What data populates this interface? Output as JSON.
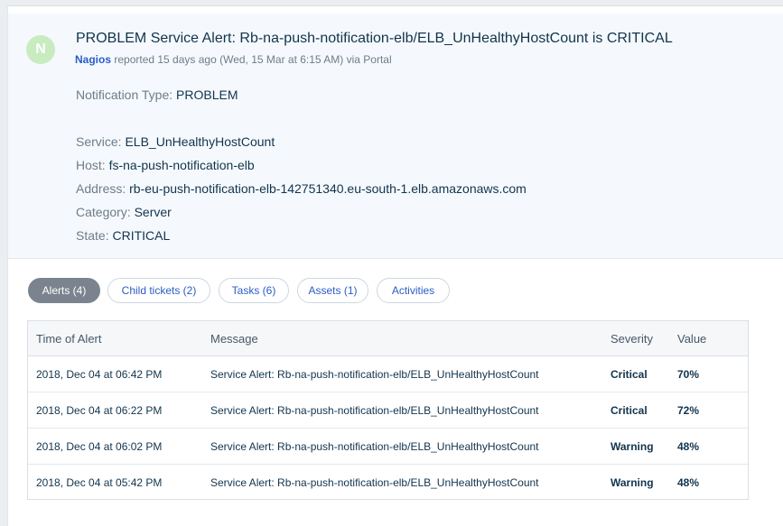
{
  "ticket": {
    "avatar_letter": "N",
    "title": "PROBLEM Service Alert: Rb-na-push-notification-elb/ELB_UnHealthyHostCount is CRITICAL",
    "agent": "Nagios",
    "meta_text": " reported 15 days ago (Wed, 15 Mar at 6:15 AM) via Portal"
  },
  "fields": {
    "notification_type_label": "Notification Type:",
    "notification_type_value": "PROBLEM",
    "service_label": "Service:",
    "service_value": "ELB_UnHealthyHostCount",
    "host_label": "Host:",
    "host_value": "fs-na-push-notification-elb",
    "address_label": "Address:",
    "address_value": "rb-eu-push-notification-elb-142751340.eu-south-1.elb.amazonaws.com",
    "category_label": "Category:",
    "category_value": "Server",
    "state_label": "State:",
    "state_value": "CRITICAL"
  },
  "tabs": [
    {
      "label": "Alerts (4)",
      "active": true
    },
    {
      "label": "Child tickets (2)",
      "active": false
    },
    {
      "label": "Tasks (6)",
      "active": false
    },
    {
      "label": "Assets (1)",
      "active": false
    },
    {
      "label": "Activities",
      "active": false
    }
  ],
  "alerts_table": {
    "columns": [
      "Time of Alert",
      "Message",
      "Severity",
      "Value"
    ],
    "rows": [
      {
        "time": "2018, Dec 04 at 06:42 PM",
        "message": "Service Alert: Rb-na-push-notification-elb/ELB_UnHealthyHostCount",
        "severity": "Critical",
        "value": "70%"
      },
      {
        "time": "2018, Dec 04 at 06:22 PM",
        "message": "Service Alert: Rb-na-push-notification-elb/ELB_UnHealthyHostCount",
        "severity": "Critical",
        "value": "72%"
      },
      {
        "time": "2018, Dec 04 at 06:02 PM",
        "message": "Service Alert: Rb-na-push-notification-elb/ELB_UnHealthyHostCount",
        "severity": "Warning",
        "value": "48%"
      },
      {
        "time": "2018, Dec 04 at 05:42 PM",
        "message": "Service Alert: Rb-na-push-notification-elb/ELB_UnHealthyHostCount",
        "severity": "Warning",
        "value": "48%"
      }
    ]
  },
  "colors": {
    "accent": "#2c5cc5",
    "avatar_bg": "#c8ebc0",
    "active_tab_bg": "#7b848e",
    "header_bg": "#f5f9fd"
  }
}
